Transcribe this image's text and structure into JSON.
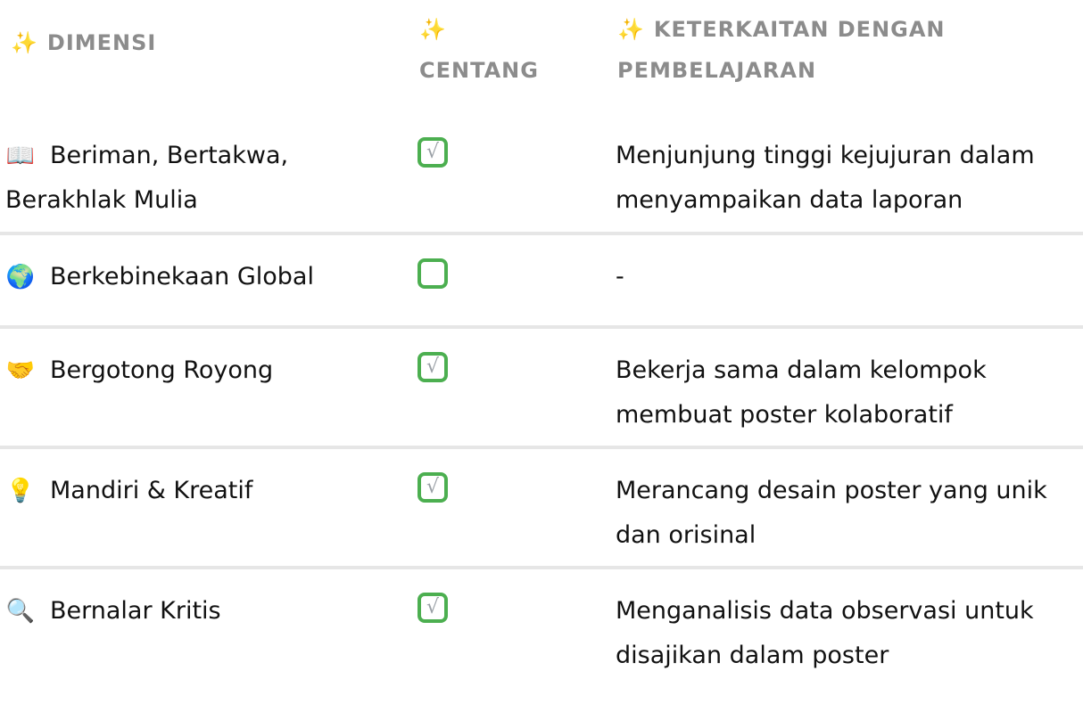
{
  "header": {
    "dimensi": "DIMENSI",
    "centang": "CENTANG",
    "keterkaitan": "KETERKAITAN DENGAN PEMBELAJARAN",
    "spark_icon": "sparkles-icon"
  },
  "rows": [
    {
      "icon": "book-icon",
      "icon_glyph": "📖",
      "dimension": "Beriman, Bertakwa, Berakhlak Mulia",
      "checked": true,
      "relation": "Menjunjung tinggi kejujuran dalam menyampaikan data laporan"
    },
    {
      "icon": "globe-icon",
      "icon_glyph": "🌍",
      "dimension": "Berkebinekaan Global",
      "checked": false,
      "relation": "-"
    },
    {
      "icon": "handshake-icon",
      "icon_glyph": "🤝",
      "dimension": "Bergotong Royong",
      "checked": true,
      "relation": "Bekerja sama dalam kelompok membuat poster kolaboratif"
    },
    {
      "icon": "lightbulb-icon",
      "icon_glyph": "💡",
      "dimension": "Mandiri & Kreatif",
      "checked": true,
      "relation": "Merancang desain poster yang unik dan orisinal"
    },
    {
      "icon": "magnifier-icon",
      "icon_glyph": "🔍",
      "dimension": "Bernalar Kritis",
      "checked": true,
      "relation": "Menganalisis data observasi untuk disajikan dalam poster"
    }
  ],
  "colors": {
    "header_text": "#8c8c8c",
    "checkbox_border": "#4caf50",
    "divider": "#e6e6e6",
    "sparkle": "#f5b800"
  },
  "check_mark": "√"
}
